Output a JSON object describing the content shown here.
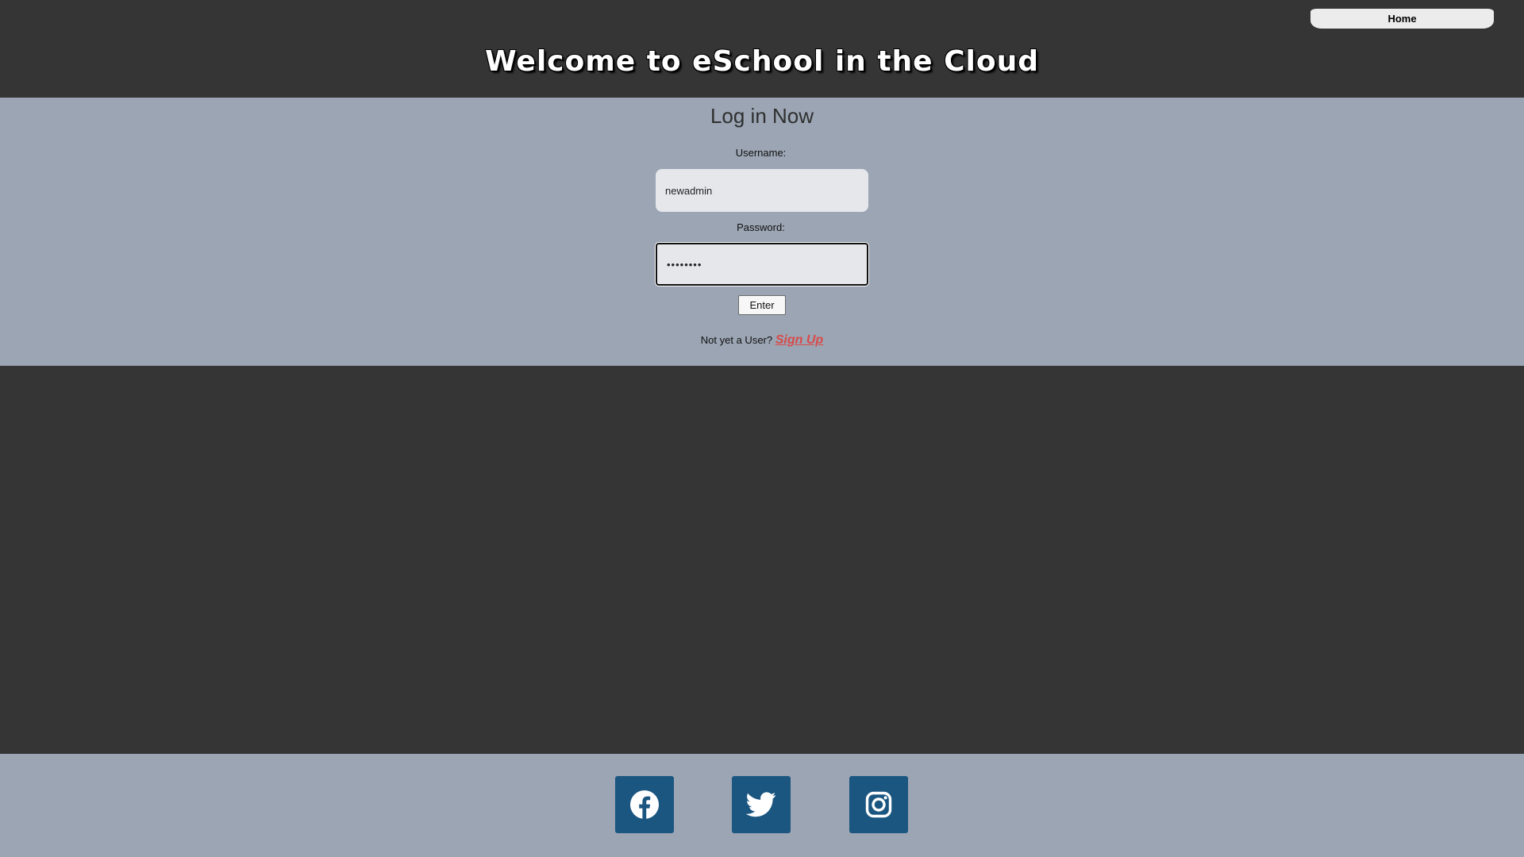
{
  "header": {
    "home_label": "Home",
    "title": "Welcome to eSchool in the Cloud"
  },
  "login": {
    "heading": "Log in Now",
    "username_label": "Username:",
    "username_value": "newadmin",
    "password_label": "Password:",
    "password_value": "password",
    "enter_label": "Enter",
    "signup_prompt": "Not yet a User?",
    "signup_link": "Sign Up"
  },
  "footer": {
    "social": [
      {
        "icon": "facebook-icon"
      },
      {
        "icon": "twitter-icon"
      },
      {
        "icon": "instagram-icon"
      }
    ]
  },
  "colors": {
    "dark_background": "#353535",
    "panel_background": "#9ba5b3",
    "input_background": "#e5e7eb",
    "signup_link": "#d94a4a",
    "social_button": "#1b5680"
  }
}
